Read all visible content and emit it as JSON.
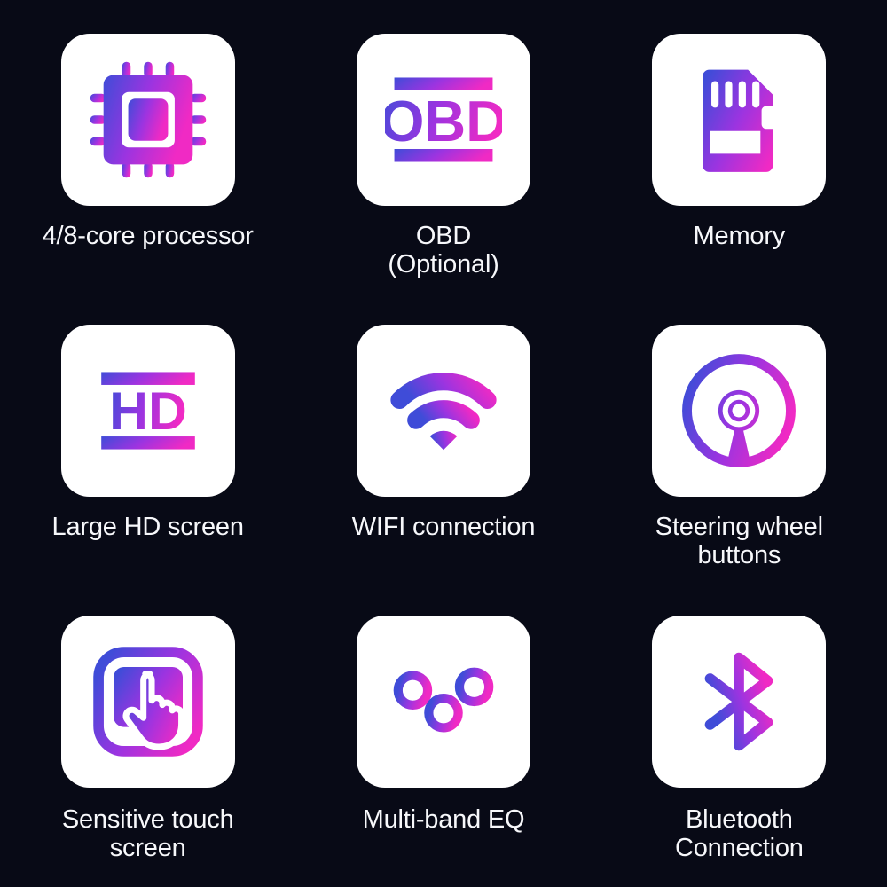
{
  "page": {
    "background_color": "#080a16",
    "tile_color": "#ffffff",
    "caption_color": "#f7f8fb",
    "gradient_start": "#3f4cd8",
    "gradient_mid": "#9b34e0",
    "gradient_end": "#f02ac4",
    "columns": 3,
    "rows": 3
  },
  "features": [
    {
      "icon": "cpu-chip-icon",
      "label_line1": "4/8-core processor",
      "label_line2": ""
    },
    {
      "icon": "obd-icon",
      "label_line1": "OBD",
      "label_line2": "(Optional)"
    },
    {
      "icon": "memory-card-icon",
      "label_line1": "Memory",
      "label_line2": ""
    },
    {
      "icon": "hd-screen-icon",
      "label_line1": "Large HD screen",
      "label_line2": ""
    },
    {
      "icon": "wifi-icon",
      "label_line1": "WIFI connection",
      "label_line2": ""
    },
    {
      "icon": "steering-wheel-icon",
      "label_line1": "Steering wheel",
      "label_line2": "buttons"
    },
    {
      "icon": "touch-screen-icon",
      "label_line1": "Sensitive touch",
      "label_line2": "screen"
    },
    {
      "icon": "equalizer-icon",
      "label_line1": "Multi-band EQ",
      "label_line2": ""
    },
    {
      "icon": "bluetooth-icon",
      "label_line1": "Bluetooth",
      "label_line2": "Connection"
    }
  ],
  "icon_text": {
    "obd": "OBD",
    "hd": "HD"
  }
}
